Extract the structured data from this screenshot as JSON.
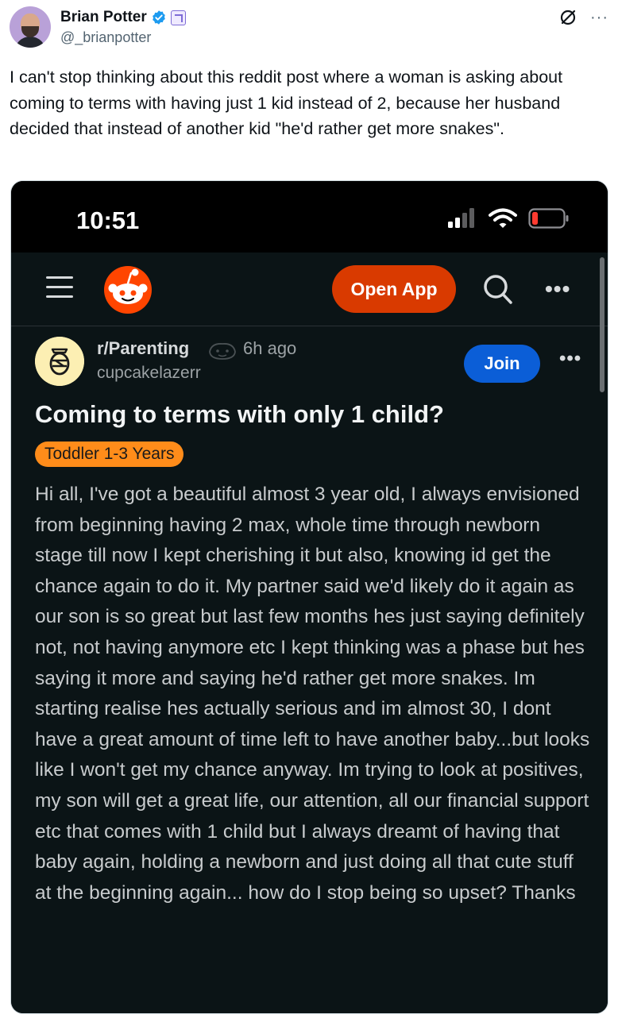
{
  "tweet": {
    "author": {
      "display_name": "Brian Potter",
      "handle": "@_brianpotter"
    },
    "text": "I can't stop thinking about this reddit post where a woman is asking about coming to terms with having just 1 kid instead of 2, because her husband decided that instead of another kid \"he'd rather get more snakes\".",
    "more_label": "···"
  },
  "phone": {
    "time": "10:51"
  },
  "reddit": {
    "open_app_label": "Open App",
    "more_label": "•••",
    "post": {
      "subreddit": "r/Parenting",
      "time_ago": "6h ago",
      "username": "cupcakelazerr",
      "join_label": "Join",
      "more_label": "•••",
      "title": "Coming to terms with only 1 child?",
      "flair": "Toddler 1-3 Years",
      "body": "Hi all, I've got a beautiful almost 3 year old, I always envisioned from beginning having 2 max, whole time through newborn stage till now I kept cherishing it but also, knowing id get the chance again to do it. My partner said we'd likely do it again as our son is so great but last few months hes just saying definitely not, not having anymore etc I kept thinking was a phase but hes saying it more and saying he'd rather get more snakes. Im starting realise hes actually serious and im almost 30, I dont have a great amount of time left to have another baby...but looks like I won't get my chance anyway. Im trying to look at positives, my son will get a great life, our attention, all our financial support etc that comes with 1 child but I always dreamt of having that baby again, holding a newborn and just doing all that cute stuff at the beginning again... how do I stop being so upset? Thanks"
    }
  },
  "colors": {
    "reddit_orange": "#d93a00",
    "join_blue": "#0b5ed7",
    "flair_orange": "#ff8c1a",
    "verified_blue": "#1d9bf0",
    "battery_red": "#ff3b30"
  },
  "icons": {
    "verified": "verified-badge-icon",
    "affiliate": "affiliate-badge-icon",
    "grok": "grok-icon",
    "hamburger": "hamburger-menu-icon",
    "reddit_logo": "reddit-snoo-icon",
    "search": "search-icon",
    "signal": "cellular-signal-icon",
    "wifi": "wifi-icon",
    "battery": "battery-icon"
  }
}
